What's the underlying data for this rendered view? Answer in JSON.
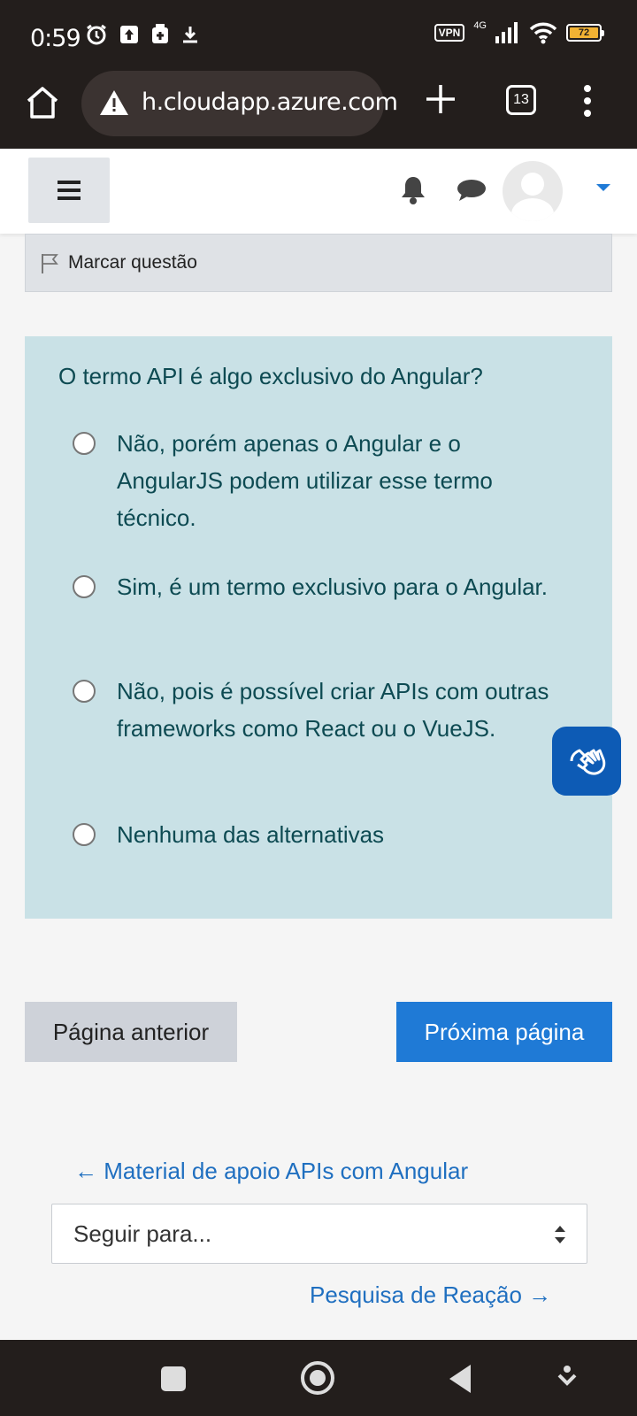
{
  "status_bar": {
    "time": "0:59",
    "vpn": "VPN",
    "network": "4G",
    "battery": "72"
  },
  "browser": {
    "url": "h.cloudapp.azure.com",
    "tab_count": "13"
  },
  "question": {
    "flag_label": "Marcar questão",
    "text": "O termo API é algo exclusivo do Angular?",
    "options": [
      {
        "label": "Não, porém apenas o Angular e o AngularJS podem utilizar esse termo técnico."
      },
      {
        "label": "Sim, é um termo exclusivo para o Angular."
      },
      {
        "label": "Não, pois é possível criar APIs com outras frameworks como React ou o VueJS."
      },
      {
        "label": "Nenhuma das alternativas"
      }
    ]
  },
  "navigation": {
    "prev_label": "Página anterior",
    "next_label": "Próxima página",
    "prev_activity": "← Material de apoio APIs com Angular",
    "jump_placeholder": "Seguir para...",
    "next_activity": "Pesquisa de Reação →"
  },
  "colors": {
    "primary": "#1f7ad6",
    "question_bg": "#c9e1e6",
    "question_text": "#0d4a52"
  }
}
